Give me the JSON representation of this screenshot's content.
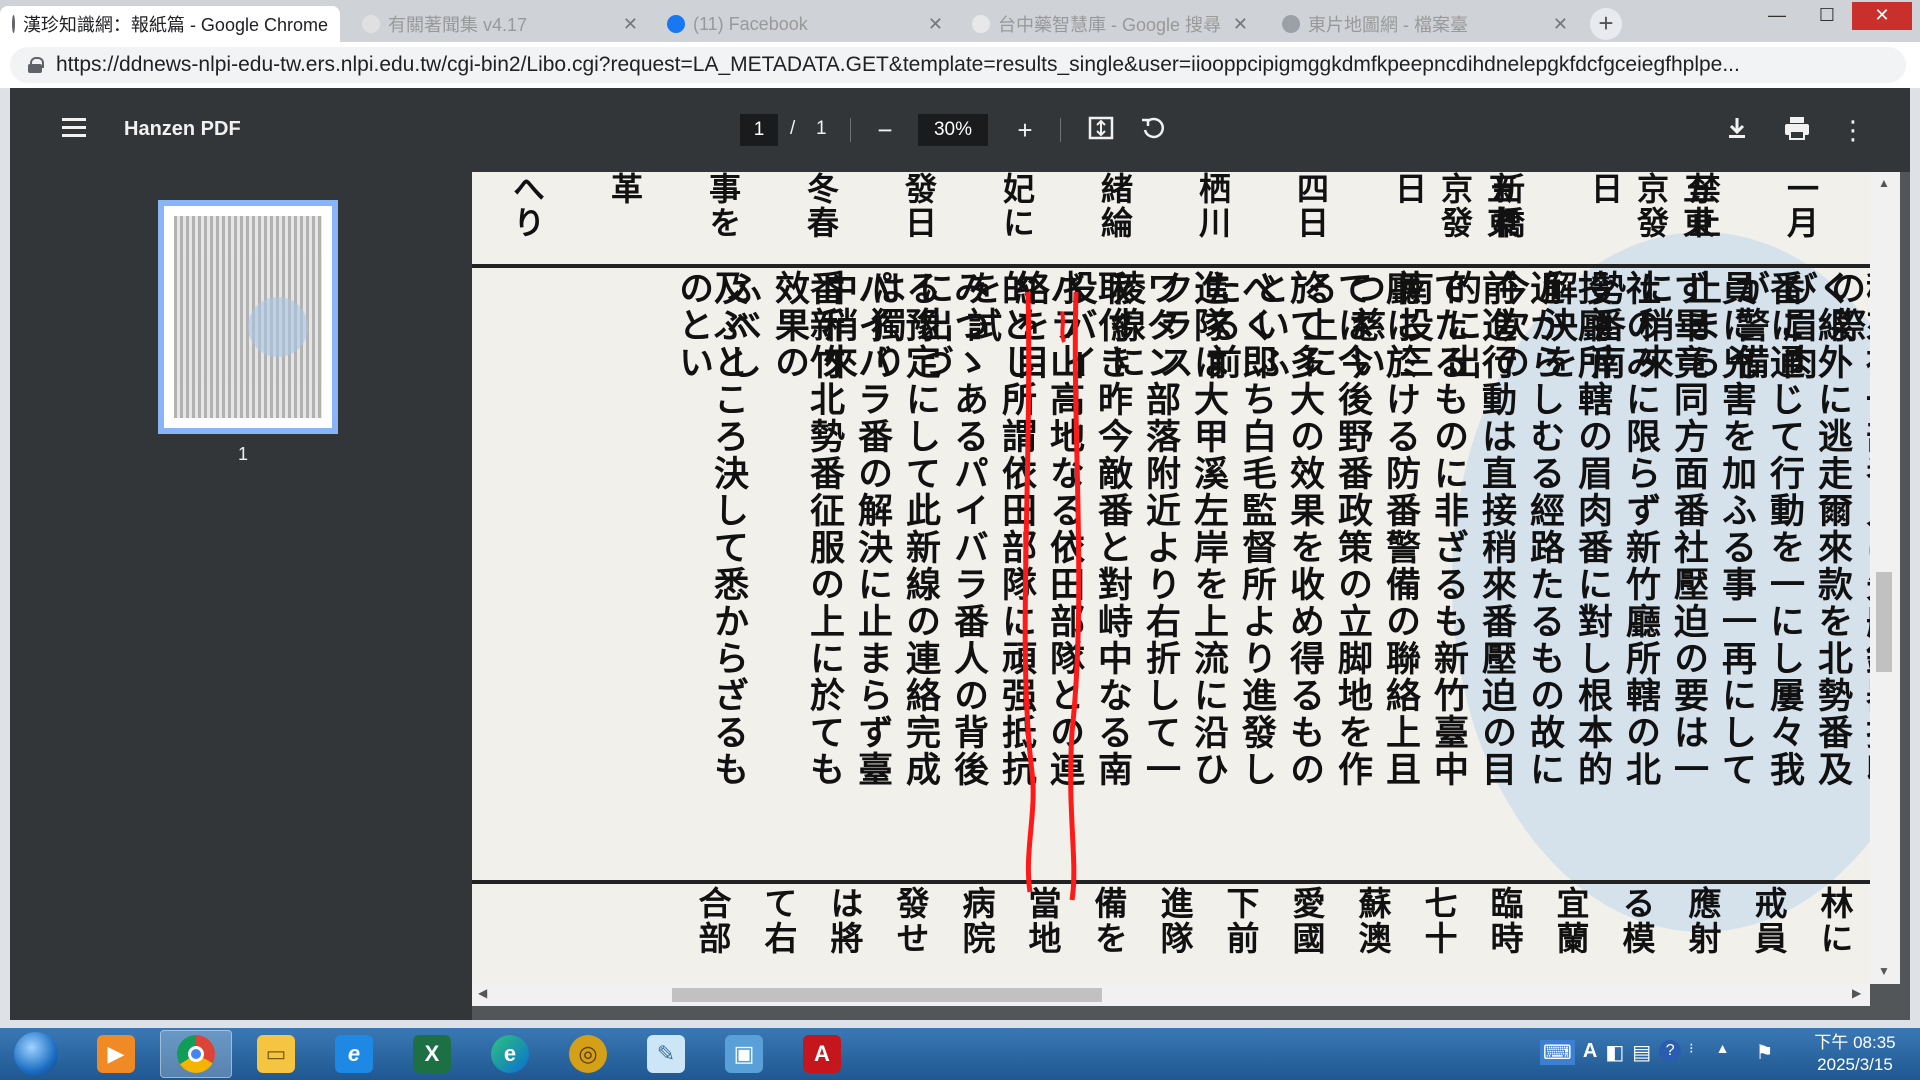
{
  "browser": {
    "active_tab_title": "漢珍知識網：報紙篇 - Google Chrome",
    "other_tabs": [
      "有關著聞集 v4.17",
      "(11) Facebook",
      "台中藥智慧庫 - Google 搜尋",
      "東片地圖網 - 檔案臺"
    ],
    "url": "https://ddnews-nlpi-edu-tw.ers.nlpi.edu.tw/cgi-bin2/Libo.cgi?request=LA_METADATA.GET&template=results_single&user=iiooppcipigmggkdmfkpeepncdihdnelepgkfdcfgceiegfhplpe..."
  },
  "pdf": {
    "title": "Hanzen PDF",
    "current_page": "1",
    "separator": "/",
    "total_pages": "1",
    "zoom": "30%",
    "thumbnail_label": "1"
  },
  "newspaper": {
    "top_columns": [
      "一月",
      "禁止",
      "五東京發日",
      "新橋",
      "五東京發日",
      "四日",
      "栖川",
      "緒綸",
      "妃に",
      "發日",
      "冬春",
      "事を",
      "革",
      "へり"
    ],
    "body_columns": [
      "及ぶところ決して悉からざるものとい",
      "ふべし",
      "番新竹北勢番征服の上に於ても效果の",
      "パイバラ番の解決に止まらず臺中稍來",
      "る豫定にして此新線の連絡完成は獨り",
      "みつゝあるパイバラ番人の背後に出づ",
      "的とし所謂依田部隊に頑强抵抗を試",
      "バラ山高地なる依田部隊との連絡を目",
      "取付き昨今敵番と對峙中なる南投バイ",
      "ワタン部落附近より右折して一稜線に",
      "進隊は大甲溪左岸を上流に沿ひクラス",
      "べく即ち白毛監督所より進發したる前",
      "於て多大の效果を收め得るものといふ",
      "ては今後野番政策の立脚地を作る上に",
      "廳に於ける防番警備の聯絡上且つ慈い",
      "でたるものに非ざるも新竹臺中南投三",
      "前進行動は直接稍來番壓迫の目的に出",
      "近からしむる經路たるもの故に今次の",
      "投廳所轄の眉肉番に對し根本的解決を",
      "社のみに限らず新竹廳所轄の北勢番南",
      "ず畢竟同方面番社壓迫の要は一に稍來",
      "員に兇害を加ふる事一再にして止まら",
      "番に通じて行動を一にし屢々我が警備",
      "く線外に逃走爾來款を北勢番及び眉肉",
      "稍來社一部番人は先般銃器押收の際"
    ],
    "bottom_columns": [
      "合部",
      "て右",
      "は將",
      "發せ",
      "病院",
      "當地",
      "備を",
      "進隊",
      "下前",
      "愛國",
      "蘇澳",
      "七十",
      "臨時",
      "宜蘭",
      "る模",
      "應射",
      "戒員",
      "林に"
    ]
  },
  "taskbar": {
    "apps": [
      "media-player",
      "chrome",
      "file-explorer",
      "internet-explorer",
      "excel",
      "edge",
      "app-circle",
      "notepad",
      "photo-viewer",
      "acrobat"
    ],
    "tray_lang": "A",
    "time": "下午 08:35",
    "date": "2025/3/15"
  },
  "colors": {
    "pdf_toolbar": "#323639",
    "pdf_background": "#525659",
    "annotation_red": "#ff1a1a",
    "taskbar": "#2a6aa8"
  }
}
